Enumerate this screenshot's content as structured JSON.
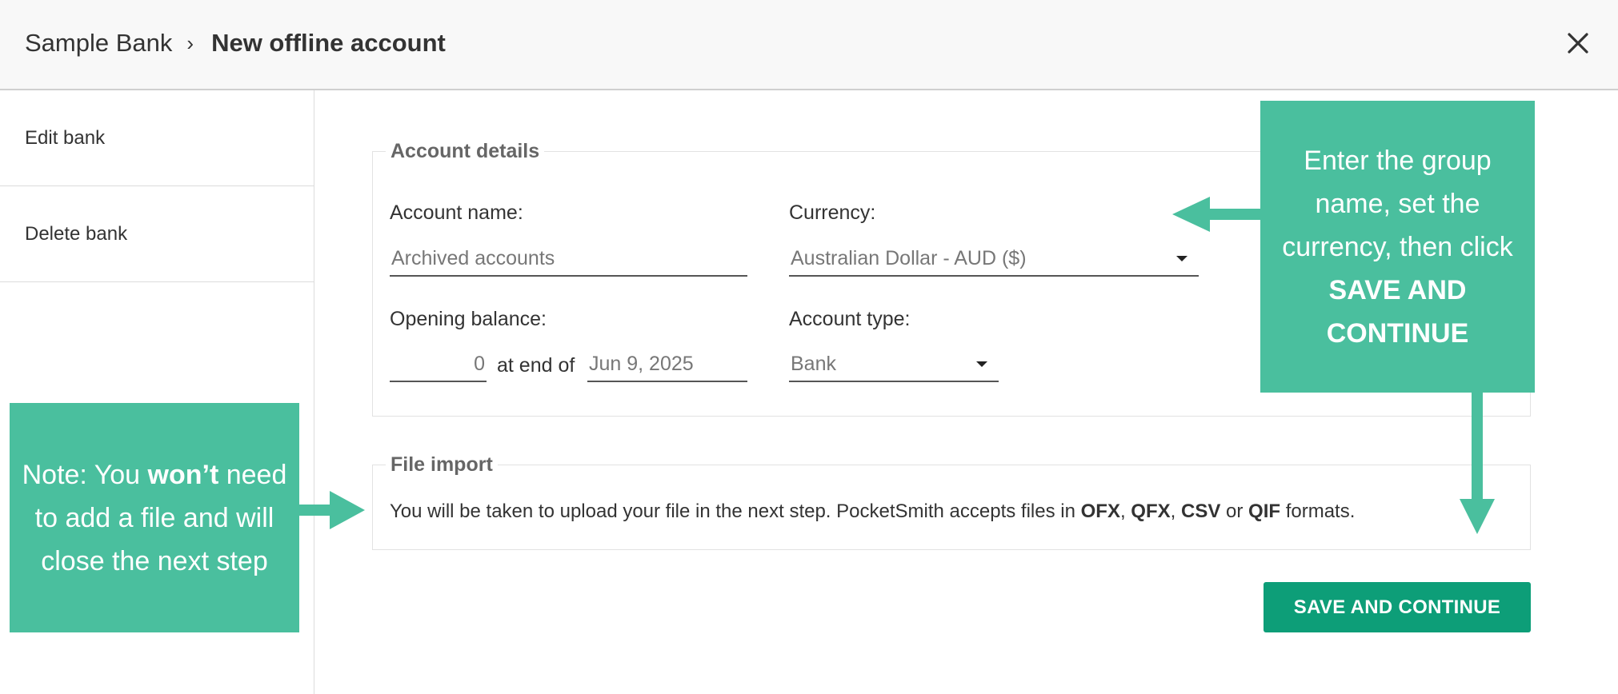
{
  "header": {
    "breadcrumb_root": "Sample Bank",
    "breadcrumb_separator": "›",
    "breadcrumb_current": "New offline account"
  },
  "sidebar": {
    "items": [
      {
        "label": "Edit bank"
      },
      {
        "label": "Delete bank"
      }
    ]
  },
  "account_details": {
    "legend": "Account details",
    "account_name_label": "Account name:",
    "account_name_value": "Archived accounts",
    "currency_label": "Currency:",
    "currency_value": "Australian Dollar - AUD ($)",
    "opening_balance_label": "Opening balance:",
    "opening_balance_value": "0",
    "at_end_of_label": "at end of",
    "date_value": "Jun 9, 2025",
    "account_type_label": "Account type:",
    "account_type_value": "Bank"
  },
  "file_import": {
    "legend": "File import",
    "text_prefix": "You will be taken to upload your file in the next step. PocketSmith accepts files in ",
    "formats": [
      "OFX",
      "QFX",
      "CSV",
      "QIF"
    ],
    "sep_comma": ", ",
    "sep_or": " or ",
    "text_suffix": " formats."
  },
  "actions": {
    "save_label": "SAVE AND CONTINUE"
  },
  "callouts": {
    "left": {
      "part1": "Note: You ",
      "bold": "won’t",
      "part2": " need to add a file and will close the next step"
    },
    "right": {
      "part1": "Enter the group name, set the currency, then click ",
      "bold": "SAVE AND CONTINUE"
    }
  },
  "colors": {
    "accent": "#0d9e78",
    "callout": "#4abf9e"
  },
  "icons": {
    "close": "close-icon",
    "dropdown": "caret-down-icon"
  }
}
